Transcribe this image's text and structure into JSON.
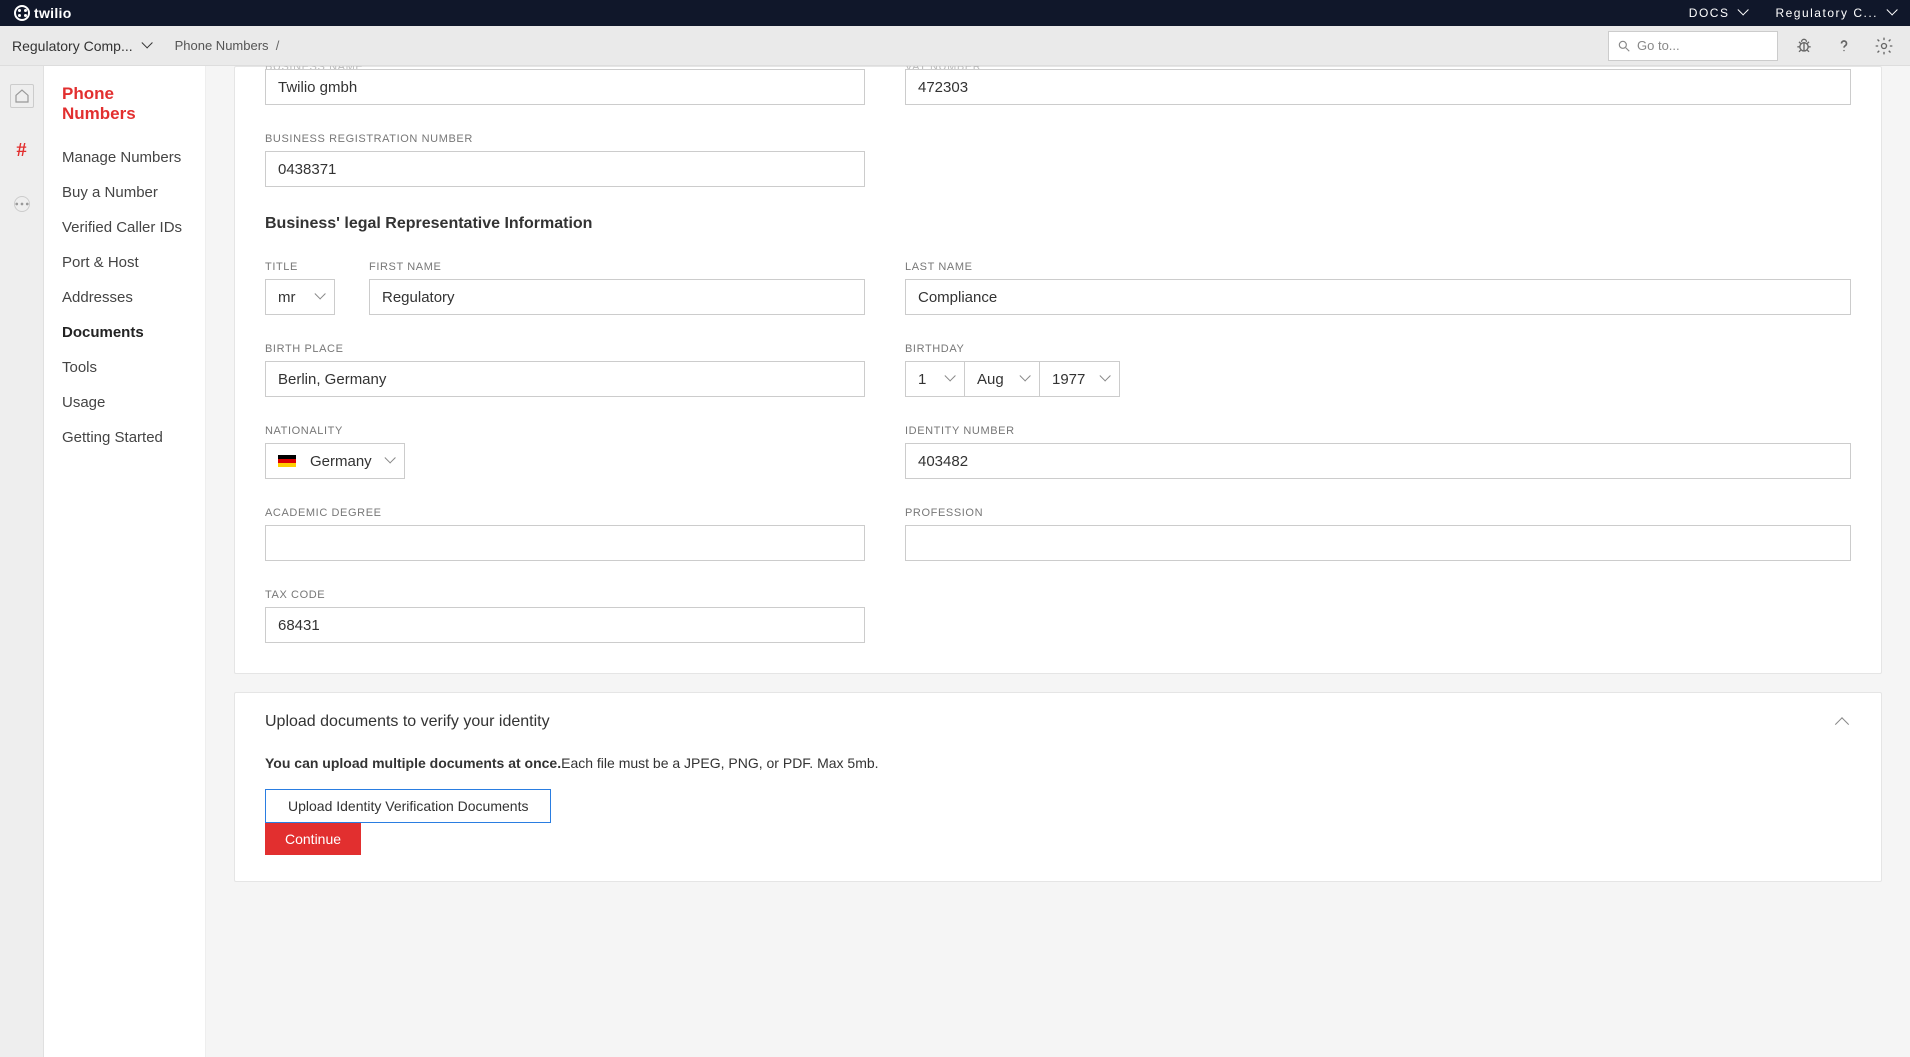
{
  "topbar": {
    "brand": "twilio",
    "docs_label": "DOCS",
    "account_label": "Regulatory C..."
  },
  "subbar": {
    "project_name": "Regulatory Comp...",
    "breadcrumb_root": "Phone Numbers",
    "breadcrumb_sep": "/",
    "search_placeholder": "Go to..."
  },
  "sidebar": {
    "title": "Phone Numbers",
    "items": [
      {
        "label": "Manage Numbers"
      },
      {
        "label": "Buy a Number"
      },
      {
        "label": "Verified Caller IDs"
      },
      {
        "label": "Port & Host"
      },
      {
        "label": "Addresses"
      },
      {
        "label": "Documents"
      },
      {
        "label": "Tools"
      },
      {
        "label": "Usage"
      },
      {
        "label": "Getting Started"
      }
    ],
    "active_index": 5
  },
  "form": {
    "business_name_label": "BUSINESS NAME",
    "business_name": "Twilio gmbh",
    "vat_label_trunc": "VAT NUMBER",
    "vat": "472303",
    "brn_label": "BUSINESS REGISTRATION NUMBER",
    "brn": "0438371",
    "section_title": "Business' legal Representative Information",
    "title_label": "TITLE",
    "title_value": "mr",
    "first_name_label": "FIRST NAME",
    "first_name": "Regulatory",
    "last_name_label": "LAST NAME",
    "last_name": "Compliance",
    "birth_place_label": "BIRTH PLACE",
    "birth_place": "Berlin, Germany",
    "birthday_label": "BIRTHDAY",
    "birthday_day": "1",
    "birthday_month": "Aug",
    "birthday_year": "1977",
    "nationality_label": "NATIONALITY",
    "nationality": "Germany",
    "identity_label": "IDENTITY NUMBER",
    "identity": "403482",
    "academic_label": "ACADEMIC DEGREE",
    "academic": "",
    "profession_label": "PROFESSION",
    "profession": "",
    "tax_label": "TAX CODE",
    "tax": "68431"
  },
  "upload": {
    "heading": "Upload documents to verify your identity",
    "desc_bold": "You can upload multiple documents at once.",
    "desc_rest": "Each file must be a JPEG, PNG, or PDF. Max 5mb.",
    "upload_button": "Upload Identity Verification Documents",
    "continue_button": "Continue"
  }
}
